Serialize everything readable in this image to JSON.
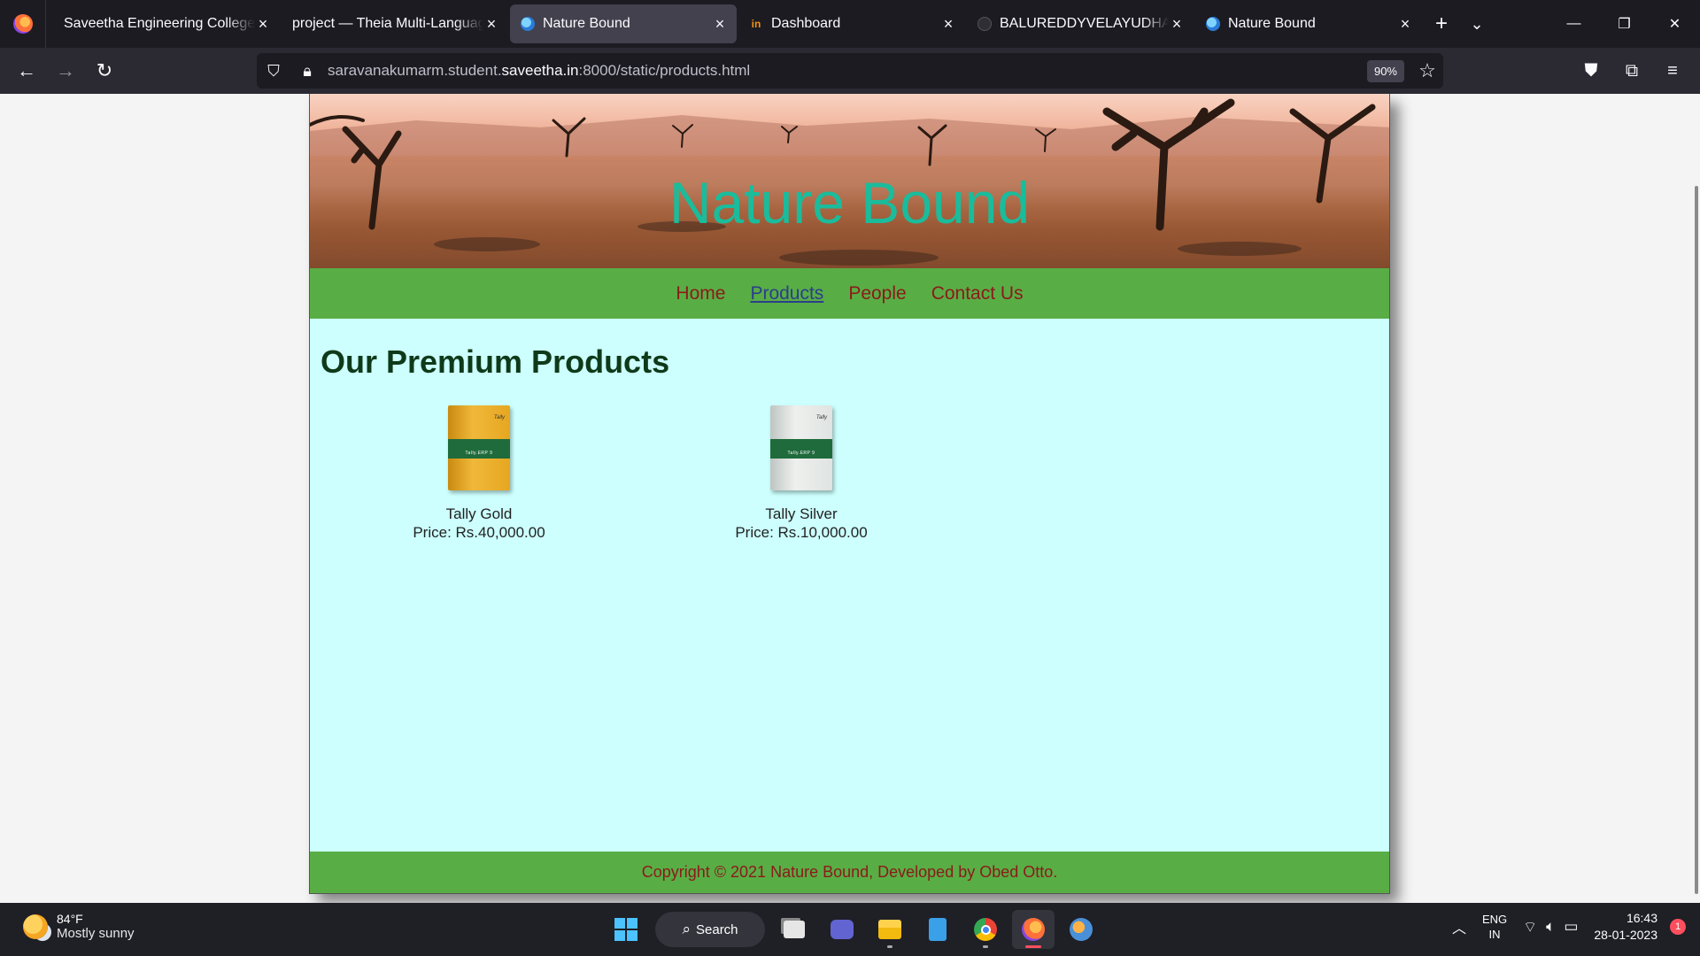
{
  "browser": {
    "tabs": [
      {
        "label": "Saveetha Engineering College",
        "icon": "none"
      },
      {
        "label": "project — Theia Multi-Language",
        "icon": "none"
      },
      {
        "label": "Nature Bound",
        "icon": "globe-icon",
        "active": true
      },
      {
        "label": "Dashboard",
        "icon": "in-icon"
      },
      {
        "label": "BALUREDDYVELAYUDHAMO",
        "icon": "github-icon"
      },
      {
        "label": "Nature Bound",
        "icon": "globe-icon"
      }
    ],
    "url_prefix": "saravanakumarm.student.",
    "url_domain": "saveetha.in",
    "url_suffix": ":8000/static/products.html",
    "zoom": "90%"
  },
  "site": {
    "title": "Nature Bound",
    "menu": [
      {
        "label": "Home"
      },
      {
        "label": "Products",
        "current": true
      },
      {
        "label": "People"
      },
      {
        "label": "Contact Us"
      }
    ],
    "heading": "Our Premium Products",
    "products": [
      {
        "name": "Tally Gold",
        "price": "Price: Rs.40,000.00",
        "box_text": "Tally.ERP 9",
        "color": "#f0b83a"
      },
      {
        "name": "Tally Silver",
        "price": "Price: Rs.10,000.00",
        "box_text": "Tally.ERP 9",
        "color": "#dfe3e1"
      }
    ],
    "footer": "Copyright © 2021 Nature Bound, Developed by Obed Otto.",
    "colors": {
      "title": "#1abc9c",
      "menu_bg": "#59ad45",
      "content_bg": "#ccfffd",
      "link": "#8b1a1a"
    }
  },
  "taskbar": {
    "temp": "84°F",
    "weather": "Mostly sunny",
    "search": "Search",
    "lang_1": "ENG",
    "lang_2": "IN",
    "time": "16:43",
    "date": "28-01-2023",
    "notifications": "1"
  }
}
